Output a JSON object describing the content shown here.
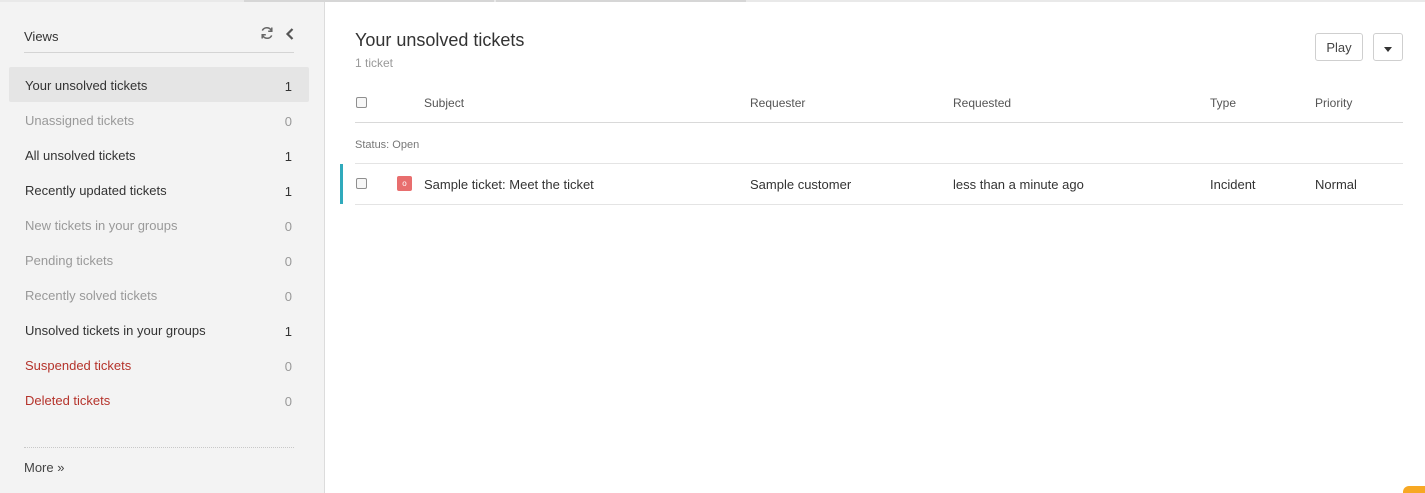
{
  "sidebar": {
    "title": "Views",
    "icons": {
      "refresh": "refresh-icon",
      "collapse": "chevron-left-icon"
    },
    "items": [
      {
        "label": "Your unsolved tickets",
        "count": "1",
        "style": "normal",
        "active": true
      },
      {
        "label": "Unassigned tickets",
        "count": "0",
        "style": "muted"
      },
      {
        "label": "All unsolved tickets",
        "count": "1",
        "style": "normal"
      },
      {
        "label": "Recently updated tickets",
        "count": "1",
        "style": "normal"
      },
      {
        "label": "New tickets in your groups",
        "count": "0",
        "style": "muted"
      },
      {
        "label": "Pending tickets",
        "count": "0",
        "style": "muted"
      },
      {
        "label": "Recently solved tickets",
        "count": "0",
        "style": "muted"
      },
      {
        "label": "Unsolved tickets in your groups",
        "count": "1",
        "style": "normal"
      },
      {
        "label": "Suspended tickets",
        "count": "0",
        "style": "red"
      },
      {
        "label": "Deleted tickets",
        "count": "0",
        "style": "red"
      }
    ],
    "more_label": "More »"
  },
  "main": {
    "title": "Your unsolved tickets",
    "count_label": "1 ticket",
    "play_label": "Play",
    "table": {
      "columns": {
        "subject": "Subject",
        "requester": "Requester",
        "requested": "Requested",
        "type": "Type",
        "priority": "Priority"
      },
      "group_label": "Status: Open",
      "rows": [
        {
          "status_letter": "o",
          "subject": "Sample ticket: Meet the ticket",
          "requester": "Sample customer",
          "requested": "less than a minute ago",
          "type": "Incident",
          "priority": "Normal"
        }
      ]
    }
  },
  "colors": {
    "accent": "#30aabc",
    "status_open": "#e86e6e",
    "danger_text": "#b5332b",
    "sidebar_bg": "#f3f3f3"
  }
}
